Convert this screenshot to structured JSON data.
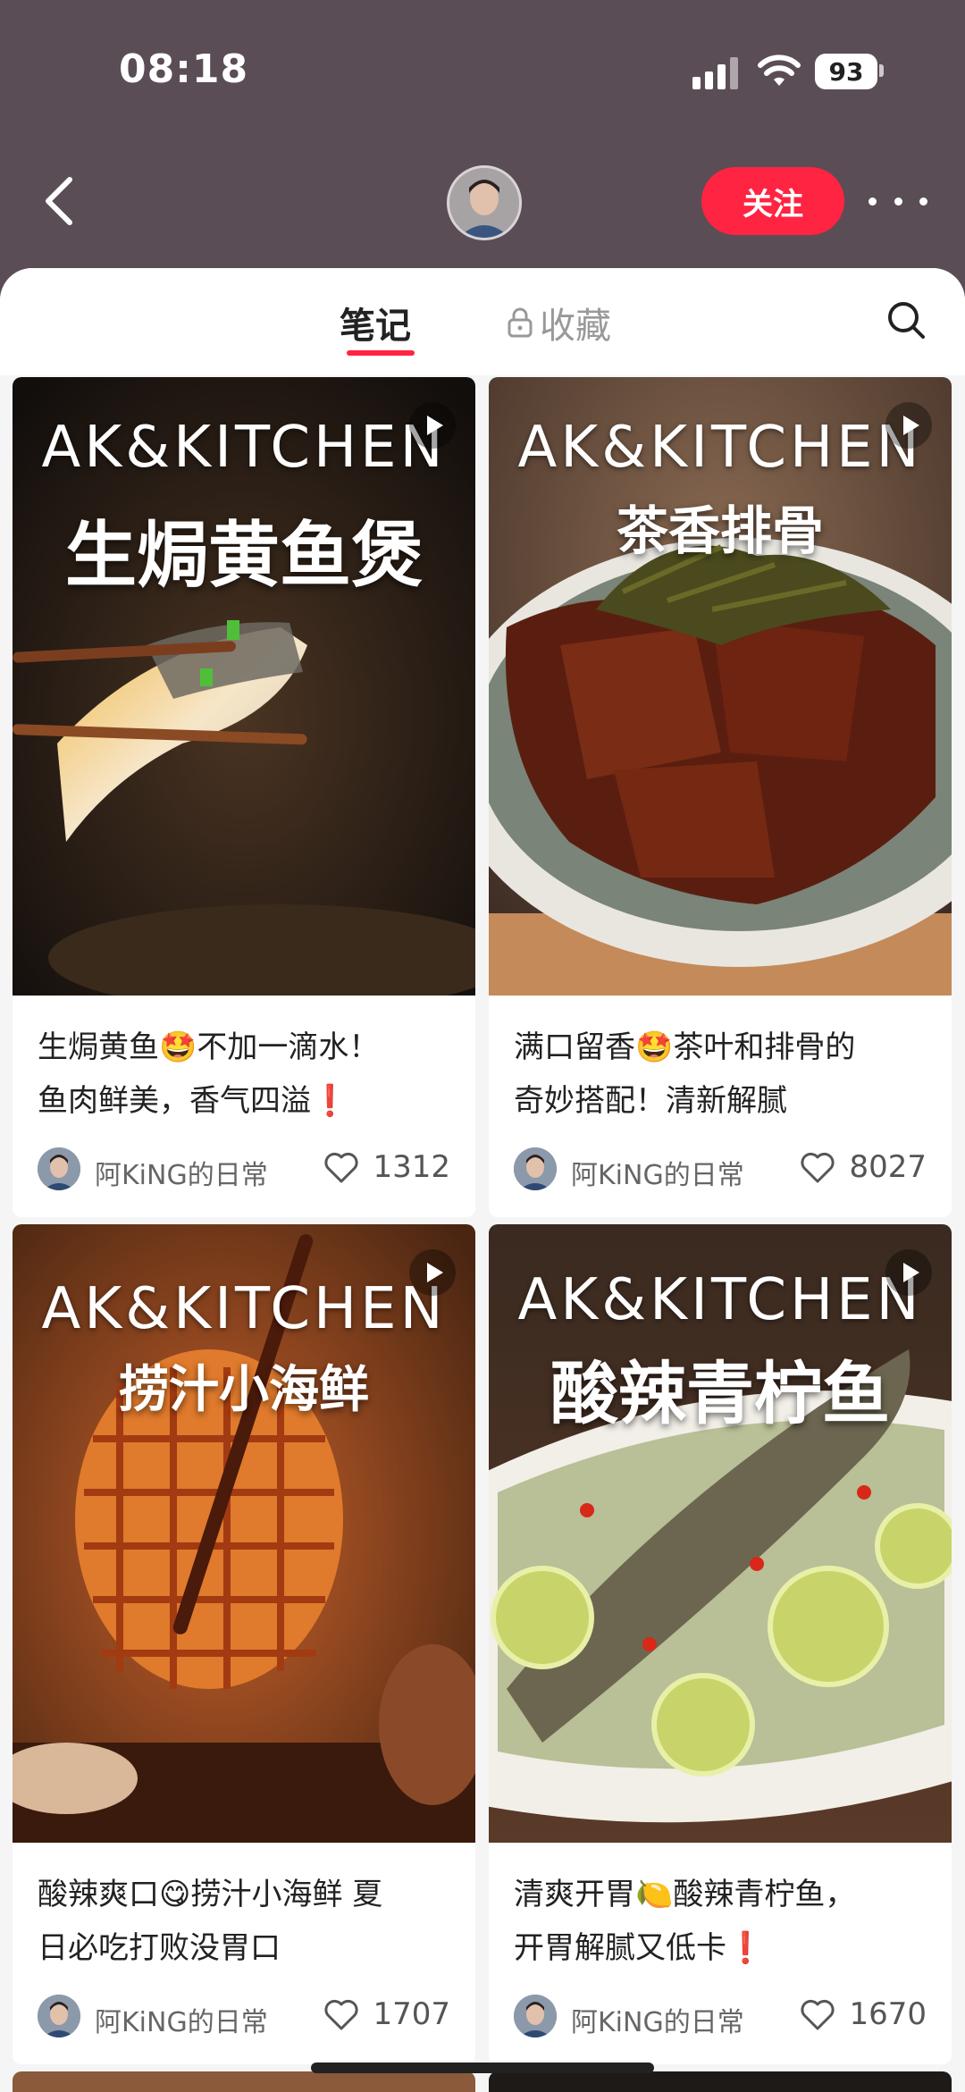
{
  "status": {
    "time": "08:18",
    "battery": "93"
  },
  "header": {
    "follow_label": "关注"
  },
  "tabs": {
    "notes": "笔记",
    "favorites": "收藏"
  },
  "notes": [
    {
      "brand": "AK&KITCHEN",
      "dish": "生焗黄鱼煲",
      "title_line1": "生焗黄鱼🤩不加一滴水！",
      "title_line2": "鱼肉鲜美，香气四溢❗",
      "author": "阿KiNG的日常",
      "likes": "1312"
    },
    {
      "brand": "AK&KITCHEN",
      "dish": "茶香排骨",
      "title_line1": "满口留香🤩茶叶和排骨的",
      "title_line2": "奇妙搭配！清新解腻",
      "author": "阿KiNG的日常",
      "likes": "8027"
    },
    {
      "brand": "AK&KITCHEN",
      "dish": "捞汁小海鲜",
      "title_line1": "酸辣爽口😋捞汁小海鲜 夏",
      "title_line2": "日必吃打败没胃口",
      "author": "阿KiNG的日常",
      "likes": "1707"
    },
    {
      "brand": "AK&KITCHEN",
      "dish": "酸辣青柠鱼",
      "title_line1": "清爽开胃🍋酸辣青柠鱼，",
      "title_line2": "开胃解腻又低卡❗",
      "author": "阿KiNG的日常",
      "likes": "1670"
    }
  ],
  "colors": {
    "accent": "#ff2442",
    "header_bg": "#5b4d56"
  }
}
